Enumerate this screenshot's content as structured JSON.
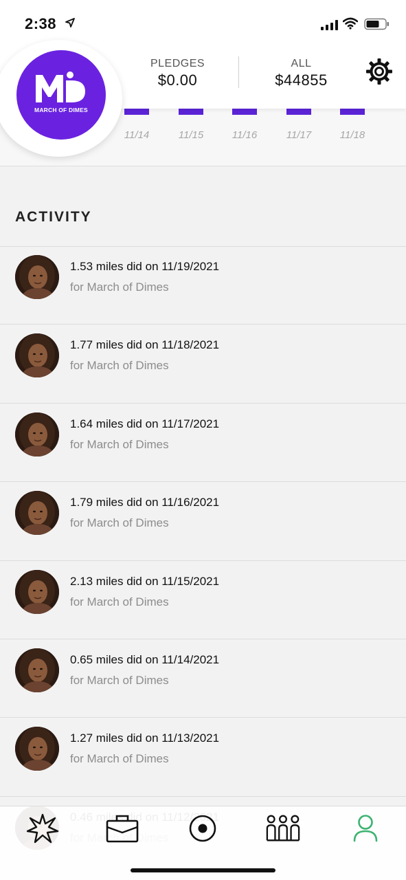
{
  "status_bar": {
    "time": "2:38"
  },
  "brand": {
    "name": "March of Dimes",
    "logo_text": "MARCH OF DIMES",
    "logo_color": "#6a22e0"
  },
  "header": {
    "pledges_label": "PLEDGES",
    "pledges_value": "$0.00",
    "all_label": "ALL",
    "all_value": "$44855"
  },
  "chart": {
    "bar_color": "#5b24d6",
    "dates": [
      "11/14",
      "11/15",
      "11/16",
      "11/17",
      "11/18"
    ]
  },
  "activity": {
    "title": "ACTIVITY",
    "items": [
      {
        "main": "1.53 miles did on 11/19/2021",
        "sub": "for March of Dimes"
      },
      {
        "main": "1.77 miles did on 11/18/2021",
        "sub": "for March of Dimes"
      },
      {
        "main": "1.64 miles did on 11/17/2021",
        "sub": "for March of Dimes"
      },
      {
        "main": "1.79 miles did on 11/16/2021",
        "sub": "for March of Dimes"
      },
      {
        "main": "2.13 miles did on 11/15/2021",
        "sub": "for March of Dimes"
      },
      {
        "main": "0.65 miles did on 11/14/2021",
        "sub": "for March of Dimes"
      },
      {
        "main": "1.27 miles did on 11/13/2021",
        "sub": "for March of Dimes"
      },
      {
        "main": "0.46 miles did on 11/12/2021",
        "sub": "for March of Dimes"
      }
    ]
  },
  "tabs": [
    {
      "icon": "impact-burst-icon"
    },
    {
      "icon": "briefcase-icon"
    },
    {
      "icon": "record-icon"
    },
    {
      "icon": "team-icon"
    },
    {
      "icon": "profile-icon",
      "active": true,
      "active_color": "#3cb371"
    }
  ]
}
